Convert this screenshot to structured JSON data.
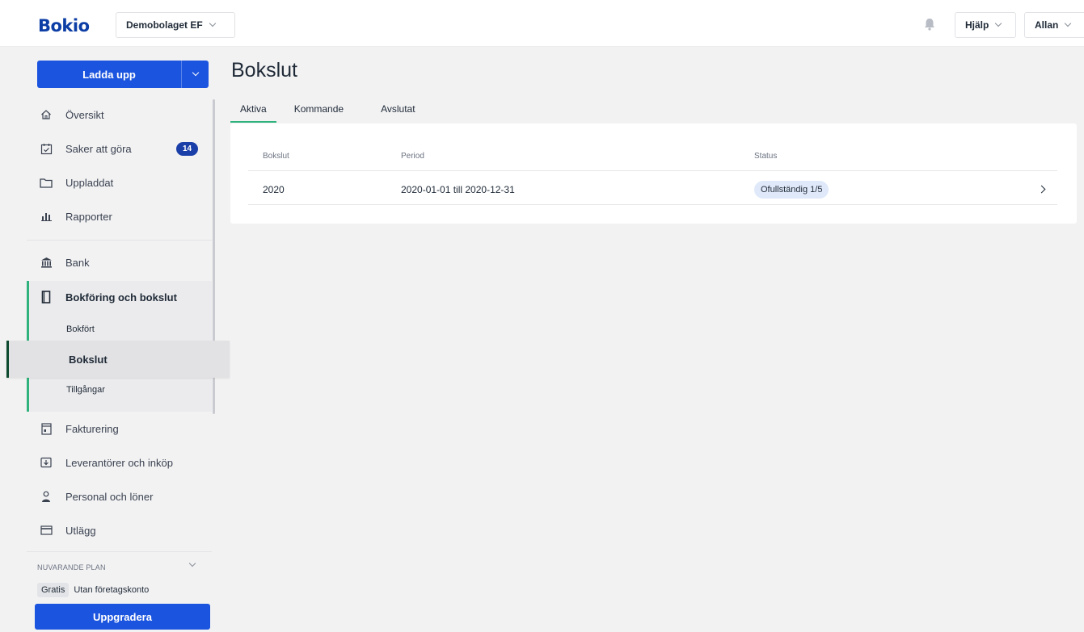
{
  "topbar": {
    "logo": "Bokio",
    "company": "Demobolaget EF",
    "help": "Hjälp",
    "user": "Allan",
    "icons": {
      "notifications": "bell-icon"
    }
  },
  "sidebar": {
    "upload_label": "Ladda upp",
    "items": [
      {
        "label": "Översikt",
        "icon": "home-icon"
      },
      {
        "label": "Saker att göra",
        "icon": "checklist-icon",
        "badge": "14"
      },
      {
        "label": "Uppladdat",
        "icon": "folder-icon"
      },
      {
        "label": "Rapporter",
        "icon": "bar-chart-icon"
      },
      {
        "label": "Bank",
        "icon": "bank-icon"
      },
      {
        "label": "Bokföring och bokslut",
        "icon": "book-icon"
      },
      {
        "label": "Fakturering",
        "icon": "invoice-icon"
      },
      {
        "label": "Leverantörer och inköp",
        "icon": "supplier-icon"
      },
      {
        "label": "Personal och löner",
        "icon": "person-icon"
      },
      {
        "label": "Utlägg",
        "icon": "card-icon"
      }
    ],
    "subitems": [
      {
        "label": "Bokfört"
      },
      {
        "label": "Bokslut"
      },
      {
        "label": "Tillgångar"
      }
    ],
    "plan": {
      "label": "NUVARANDE PLAN",
      "tier": "Gratis",
      "detail": "Utan företagskonto",
      "upgrade_label": "Uppgradera"
    }
  },
  "main": {
    "title": "Bokslut",
    "tabs": [
      {
        "label": "Aktiva",
        "active": true
      },
      {
        "label": "Kommande"
      },
      {
        "label": "Avslutat"
      }
    ],
    "table": {
      "headers": [
        "Bokslut",
        "Period",
        "Status"
      ],
      "rows": [
        {
          "bokslut": "2020",
          "period": "2020-01-01 till 2020-12-31",
          "status": "Ofullständig 1/5"
        }
      ]
    }
  },
  "colors": {
    "brand": "#0c3ea6",
    "primary_button": "#1b54de",
    "accent_green": "#2fb27c",
    "badge": "#1b3fa8",
    "status_pill": "#dfe9f9"
  }
}
